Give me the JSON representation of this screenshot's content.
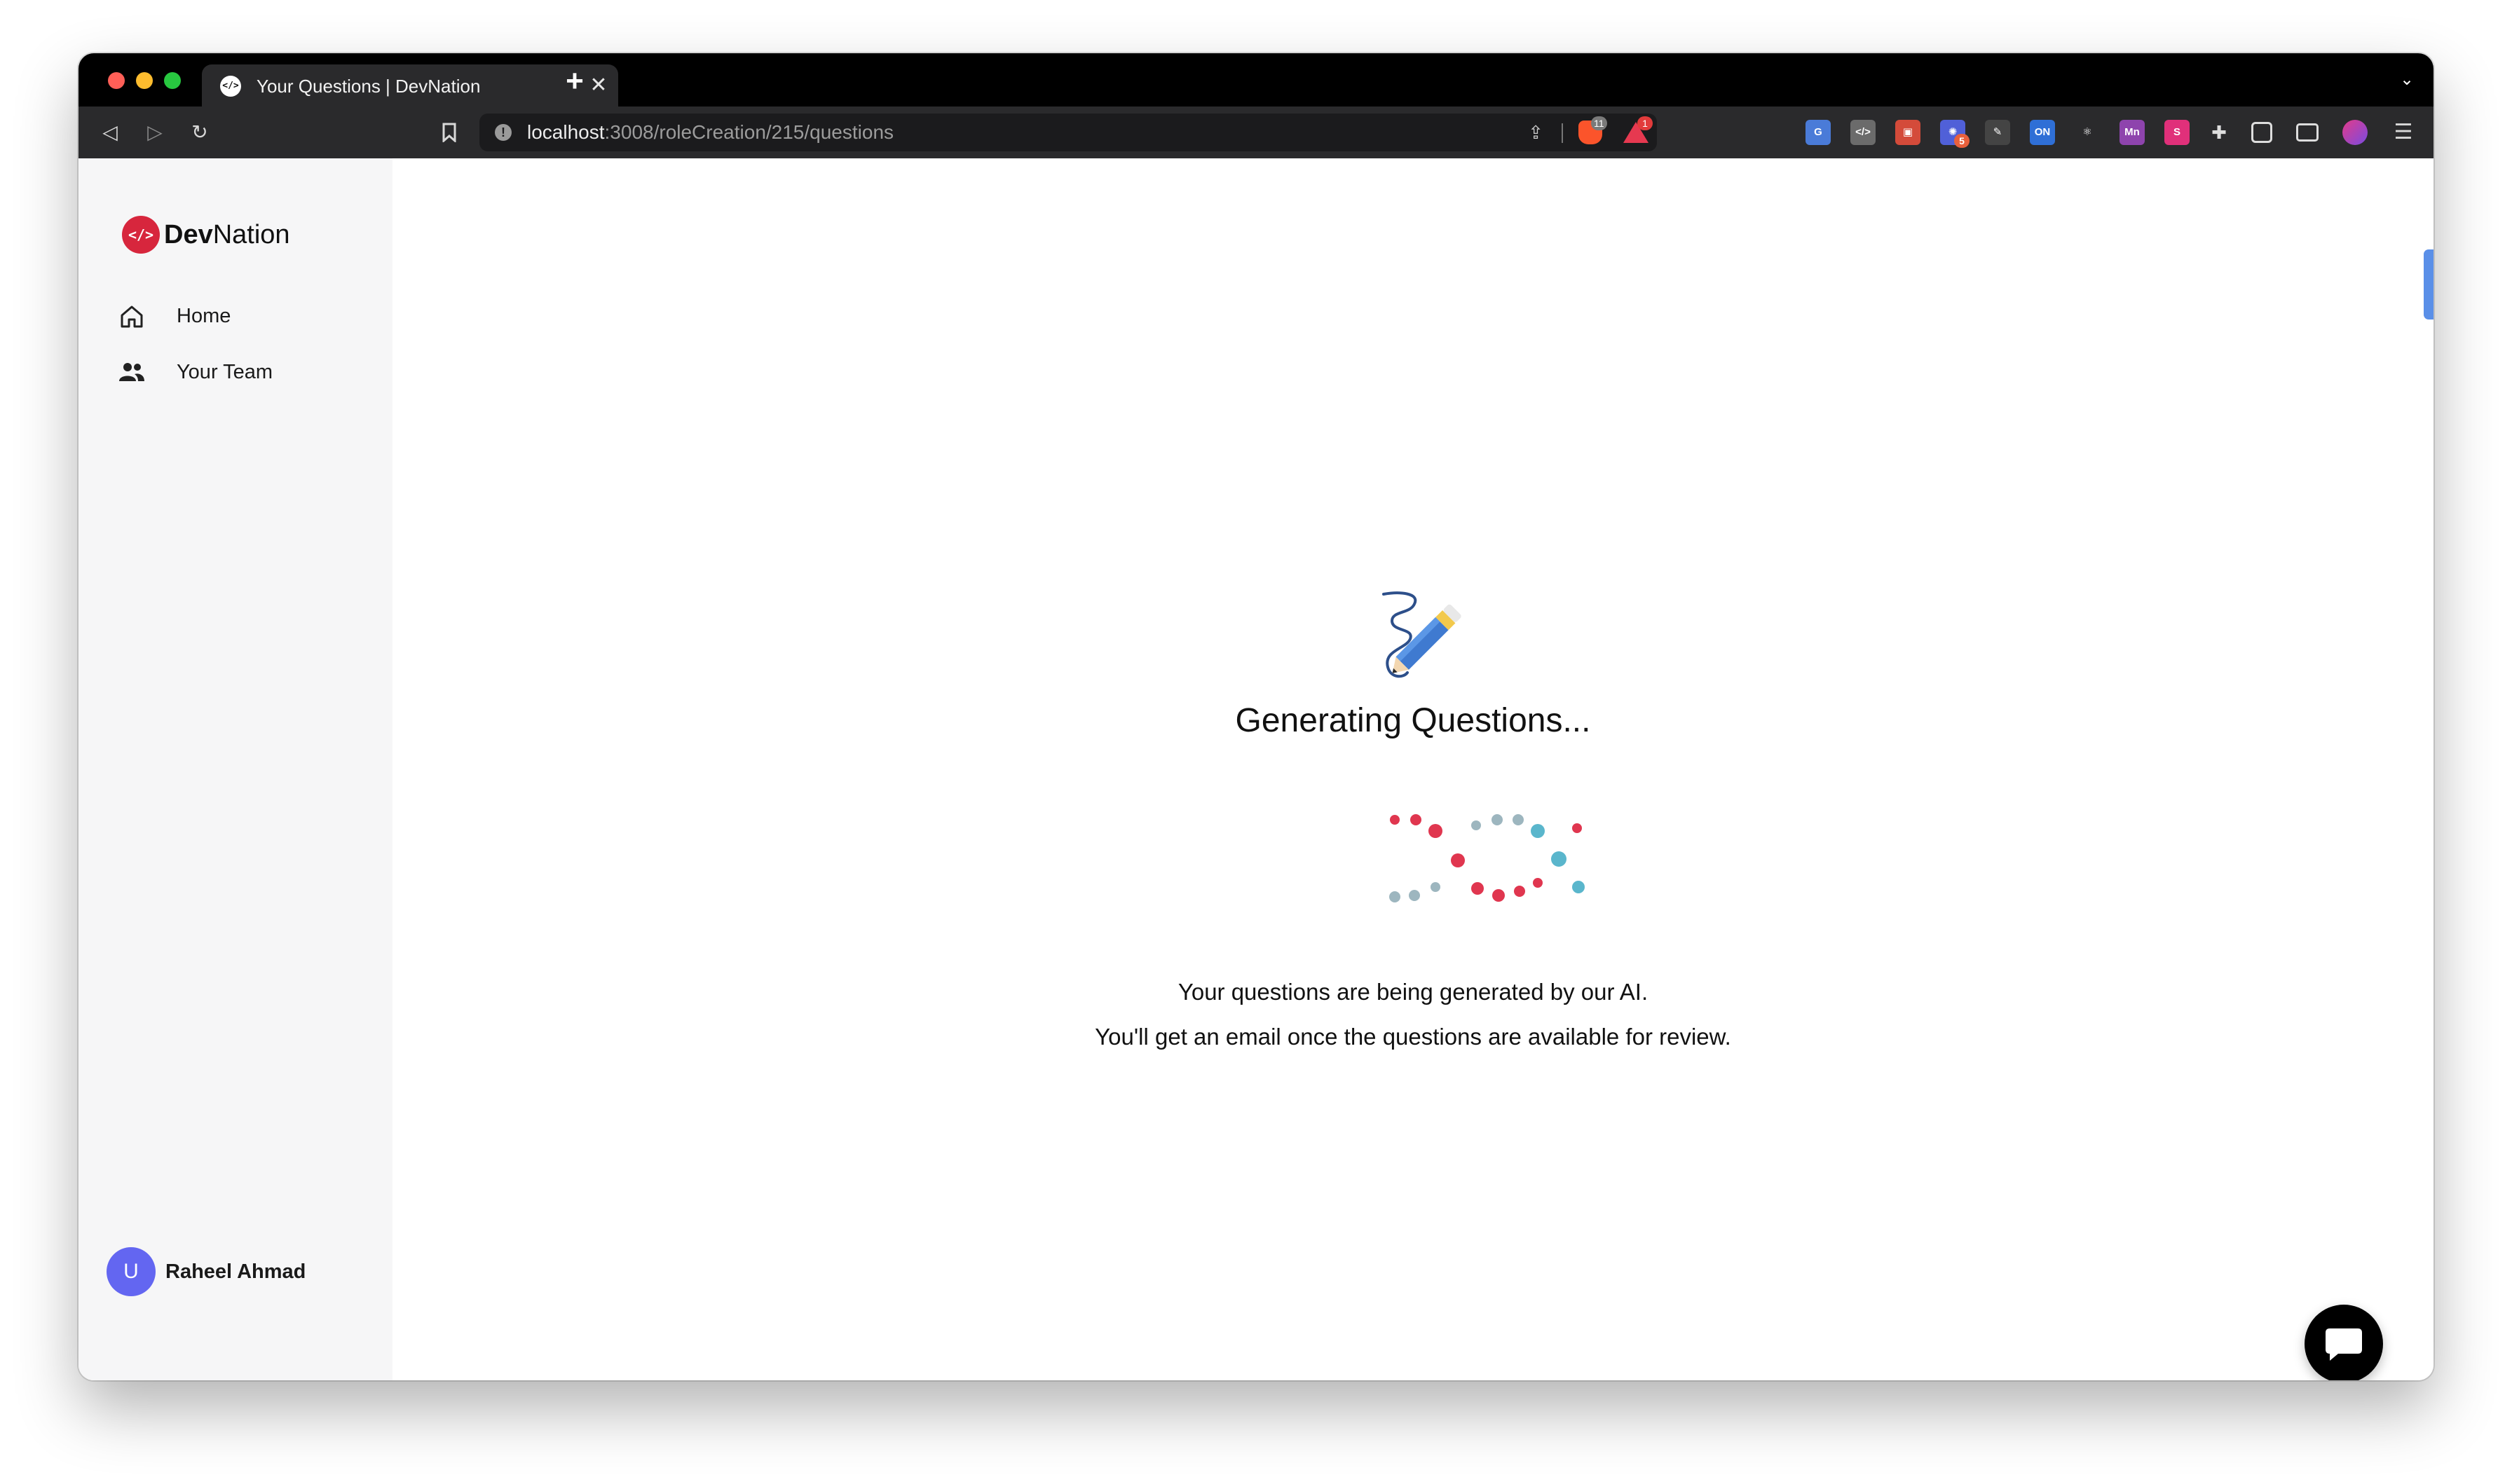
{
  "browser": {
    "tab_title": "Your Questions | DevNation",
    "tab_close": "✕",
    "new_tab": "+",
    "tab_list": "⌄",
    "url_host": "localhost",
    "url_path": ":3008/roleCreation/215/questions",
    "shield_count": "11",
    "rewards_count": "1",
    "extension_badge": "5",
    "extensions": [
      {
        "name": "translate-extension",
        "label": "G",
        "color": "#4a7bd8"
      },
      {
        "name": "code-extension",
        "label": "</>",
        "color": "#6b6b6b"
      },
      {
        "name": "red-extension",
        "label": "▣",
        "color": "#d44b3a"
      },
      {
        "name": "gear-extension",
        "label": "✺",
        "color": "#5060d8"
      },
      {
        "name": "pen-extension",
        "label": "✎",
        "color": "#444444"
      },
      {
        "name": "on-extension",
        "label": "ON",
        "color": "#2f6fd6"
      },
      {
        "name": "react-extension",
        "label": "⚛",
        "color": "#2a2a2c"
      },
      {
        "name": "mn-extension",
        "label": "Mn",
        "color": "#8e44ad"
      },
      {
        "name": "s-extension",
        "label": "S",
        "color": "#e0307a"
      }
    ]
  },
  "sidebar": {
    "logo_bold": "Dev",
    "logo_regular": "Nation",
    "logo_mark": "</>",
    "items": [
      {
        "label": "Home",
        "icon": "home-icon"
      },
      {
        "label": "Your Team",
        "icon": "team-icon"
      }
    ],
    "user": {
      "initial": "U",
      "name": "Raheel Ahmad"
    }
  },
  "main": {
    "title": "Generating Questions...",
    "line1": "Your questions are being generated by our AI.",
    "line2": "You'll get an email once the questions are available for review."
  },
  "colors": {
    "accent": "#d7263d",
    "avatar": "#6366f1",
    "loader_red": "#e0364f",
    "loader_teal": "#5ab6cc",
    "loader_gray": "#9db6bf"
  }
}
